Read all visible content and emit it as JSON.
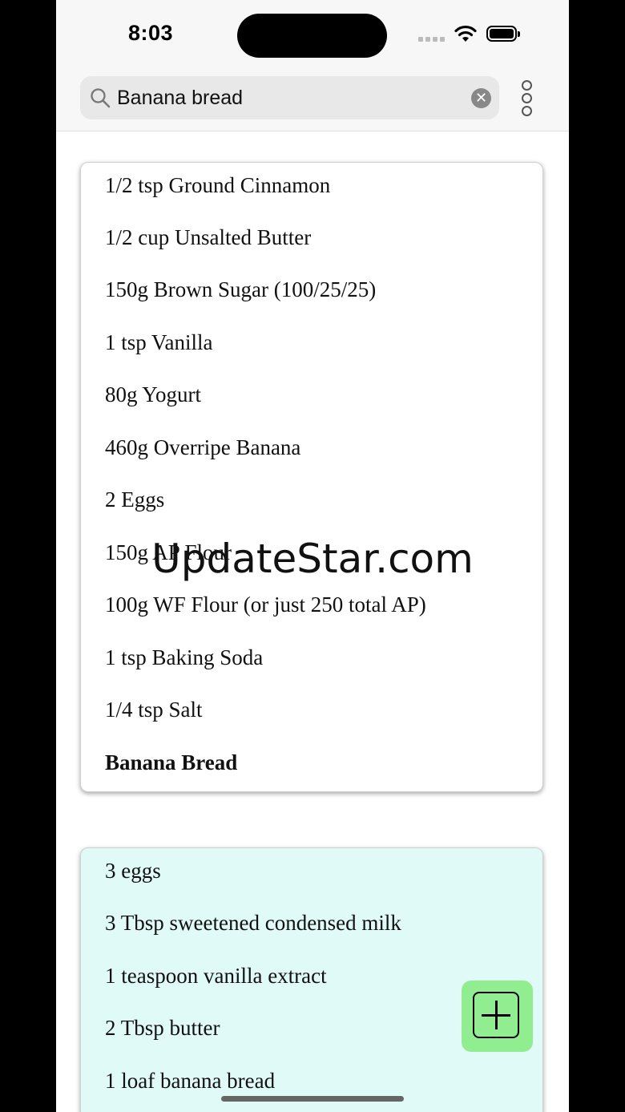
{
  "status_bar": {
    "time": "8:03"
  },
  "search": {
    "value": "Banana bread",
    "clear_label": "✕"
  },
  "cards": [
    {
      "items": [
        "1/2 tsp Ground Cinnamon",
        "1/2 cup Unsalted Butter",
        "150g Brown Sugar (100/25/25)",
        "1 tsp Vanilla",
        "80g Yogurt",
        "460g Overripe Banana",
        "2 Eggs",
        "150g AP Flour",
        "100g WF Flour (or just 250 total AP)",
        "1 tsp Baking Soda",
        "1/4 tsp Salt"
      ],
      "title": "Banana Bread",
      "background": "#ffffff"
    },
    {
      "items": [
        "3 eggs",
        "3 Tbsp sweetened condensed milk",
        "1 teaspoon vanilla extract",
        "2 Tbsp butter",
        "1 loaf banana bread"
      ],
      "background": "#e0faf8"
    }
  ],
  "watermark": "UpdateStar.com",
  "colors": {
    "fab": "#90ee90",
    "caret": "#22c422",
    "card2": "#e0faf8"
  },
  "icons": {
    "search": "magnifier-icon",
    "menu": "vertical-dots-icon",
    "fab": "add-square-icon"
  }
}
